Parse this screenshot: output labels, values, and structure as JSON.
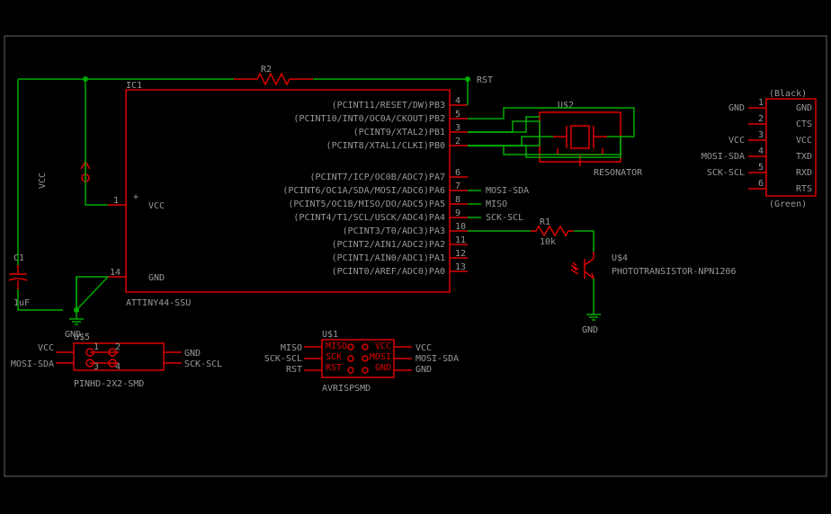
{
  "ic1": {
    "ref": "IC1",
    "value": "ATTINY44-SSU",
    "vcc": "VCC",
    "gnd": "GND",
    "pins_right": [
      "(PCINT11/RESET/DW)PB3",
      "(PCINT10/INT0/OC0A/CKOUT)PB2",
      "(PCINT9/XTAL2)PB1",
      "(PCINT8/XTAL1/CLKI)PB0",
      "(PCINT7/ICP/OC0B/ADC7)PA7",
      "(PCINT6/OC1A/SDA/MOSI/ADC6)PA6",
      "(PCINT5/OC1B/MISO/DO/ADC5)PA5",
      "(PCINT4/T1/SCL/USCK/ADC4)PA4",
      "(PCINT3/T0/ADC3)PA3",
      "(PCINT2/AIN1/ADC2)PA2",
      "(PCINT1/AIN0/ADC1)PA1",
      "(PCINT0/AREF/ADC0)PA0"
    ],
    "pin_nums": {
      "vcc": "1",
      "gnd": "14",
      "pb3": "4",
      "pb2": "5",
      "pb1": "3",
      "pb0": "2",
      "pa7": "6",
      "pa6": "7",
      "pa5": "8",
      "pa4": "9",
      "pa3": "10",
      "pa2": "11",
      "pa1": "12",
      "pa0": "13"
    }
  },
  "r1": {
    "ref": "R1",
    "value": "10k"
  },
  "r2": {
    "ref": "R2"
  },
  "c1": {
    "ref": "C1",
    "value": "1uF"
  },
  "us1": {
    "ref": "U$1",
    "value": "AVRISPSMD",
    "pins": [
      "MISO",
      "SCK",
      "RST",
      "VCC",
      "MOSI",
      "GND"
    ]
  },
  "us2": {
    "ref": "U$2",
    "value": "RESONATOR"
  },
  "us4": {
    "ref": "U$4",
    "value": "PHOTOTRANSISTOR-NPN1206"
  },
  "us5": {
    "ref": "U$5",
    "value": "PINHD-2X2-SMD",
    "pins": [
      "1",
      "2",
      "3",
      "4"
    ]
  },
  "ftdi": {
    "top": "(Black)",
    "bottom": "(Green)",
    "pins": [
      "GND",
      "CTS",
      "VCC",
      "TXD",
      "RXD",
      "RTS"
    ],
    "nums": [
      "1",
      "2",
      "3",
      "4",
      "5",
      "6"
    ]
  },
  "nets": {
    "rst": "RST",
    "vcc": "VCC",
    "gnd": "GND",
    "mosi_sda": "MOSI-SDA",
    "miso": "MISO",
    "sck_scl": "SCK-SCL"
  }
}
